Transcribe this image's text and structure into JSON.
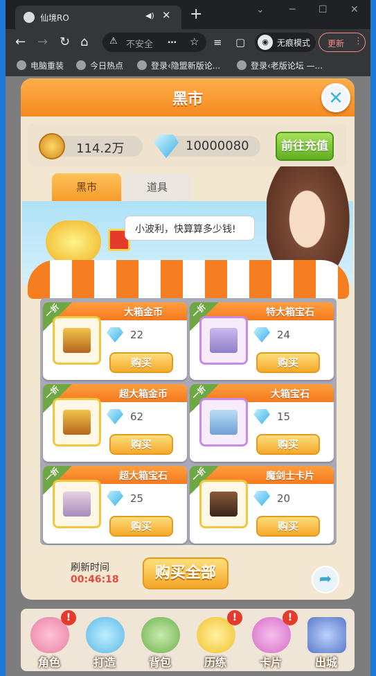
{
  "browser": {
    "tab_title": "仙境RO",
    "window_controls": [
      "⌄",
      "─",
      "☐",
      "✕"
    ],
    "address_warning": "不安全",
    "address_ellipsis": "…",
    "incognito_label": "无痕模式",
    "update_label": "更新",
    "bookmarks": [
      "电脑重装",
      "今日热点",
      "登录‹隐盟新版论...",
      "登录‹老版论坛 —..."
    ]
  },
  "game": {
    "title": "黑市",
    "gold": "114.2万",
    "diamonds": "10000080",
    "recharge_label": "前往充值",
    "tabs": [
      "黑市",
      "道具"
    ],
    "speech": "小波利，快算算多少钱!",
    "discount_label": "一折",
    "buy_label": "购买",
    "items": [
      {
        "name": "大箱金币",
        "price": "22"
      },
      {
        "name": "特大箱宝石",
        "price": "24"
      },
      {
        "name": "超大箱金币",
        "price": "62"
      },
      {
        "name": "大箱宝石",
        "price": "15"
      },
      {
        "name": "超大箱宝石",
        "price": "25"
      },
      {
        "name": "魔剑士卡片",
        "price": "20"
      }
    ],
    "refresh_label": "刷新时间",
    "refresh_time": "00:46:18",
    "buy_all_label": "购买全部",
    "nav": [
      "角色",
      "打造",
      "背包",
      "历练",
      "卡片",
      "出城"
    ],
    "badge": "!"
  },
  "colors": {
    "accent": "#f58a20",
    "green": "#6ea844",
    "timer": "#e64a3a"
  }
}
